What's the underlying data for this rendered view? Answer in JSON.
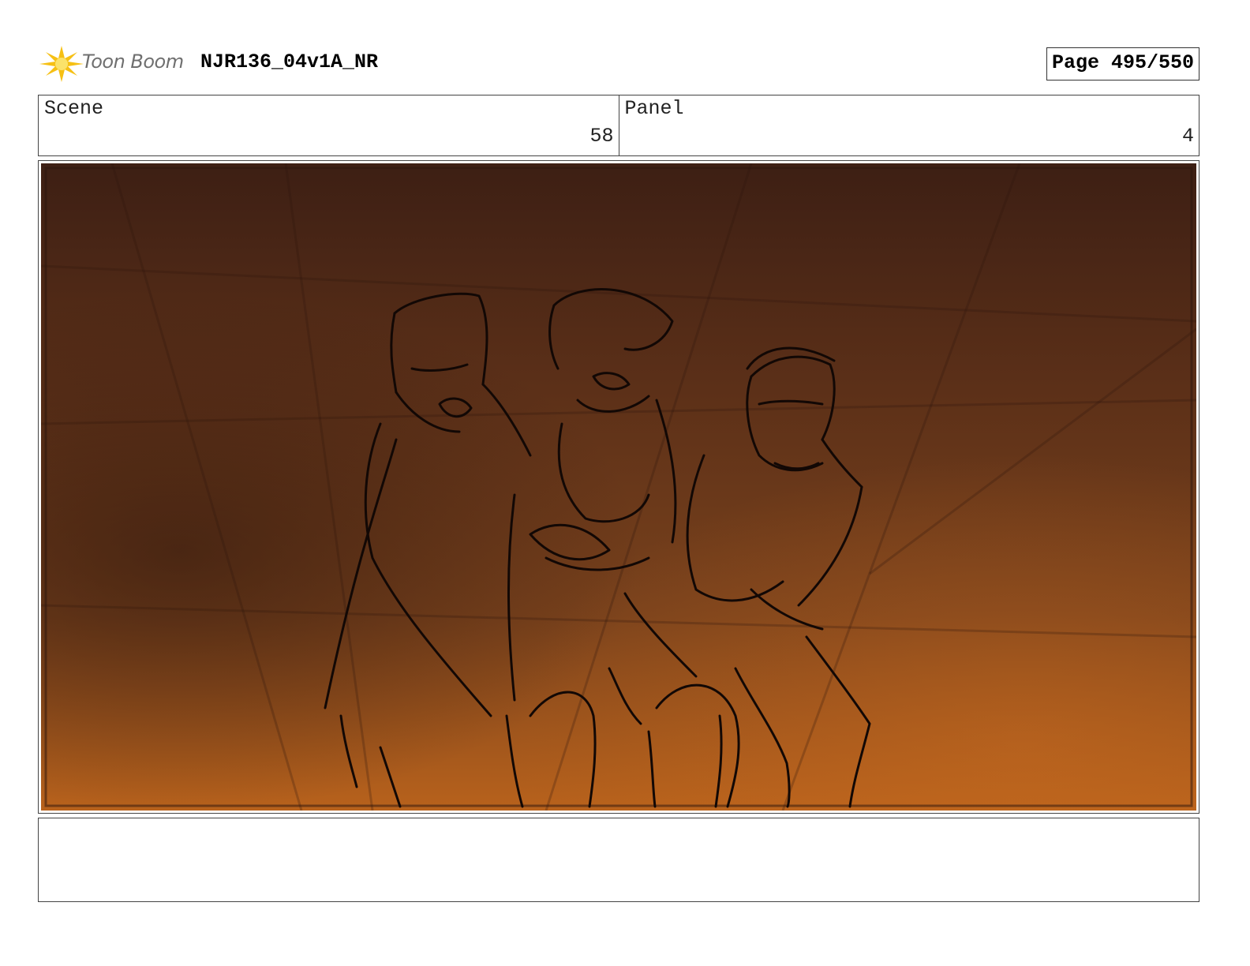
{
  "header": {
    "logo_text": "Toon Boom",
    "project_title": "NJR136_04v1A_NR",
    "page_label": "Page 495/550"
  },
  "info": {
    "scene_label": "Scene",
    "scene_value": "58",
    "panel_label": "Panel",
    "panel_value": "4"
  },
  "panel": {
    "icon": "storyboard-sketch-image",
    "colors": {
      "dark": "#3d1f14",
      "mid": "#6b3a1e",
      "light": "#b8621c"
    }
  },
  "notes": {
    "text": ""
  }
}
